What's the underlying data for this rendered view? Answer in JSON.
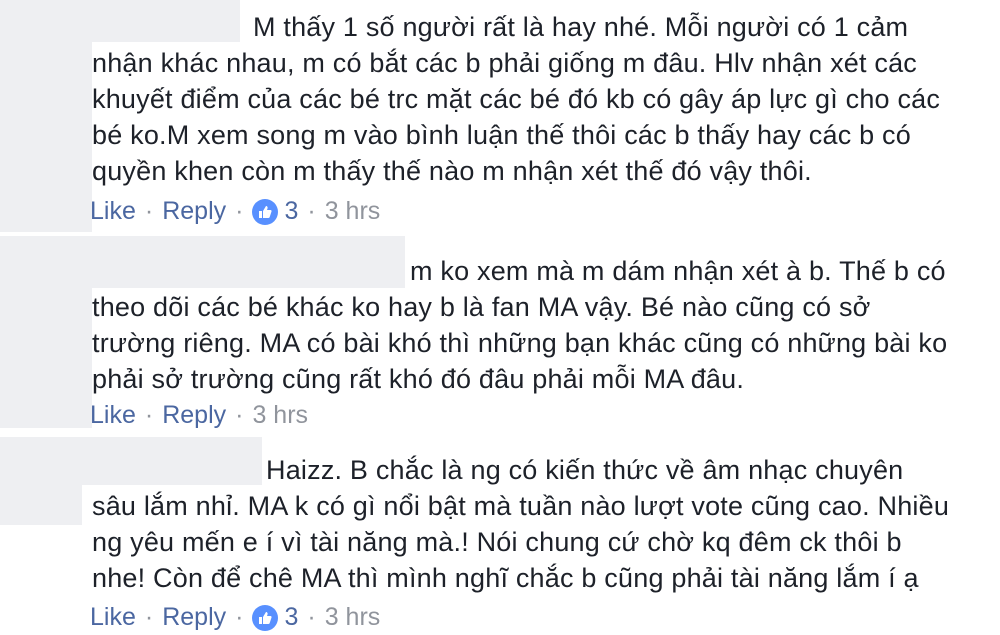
{
  "comments": [
    {
      "lines": [
        "M thấy 1 số người rất là hay nhé. Mỗi người có 1 cảm",
        "nhận khác nhau, m có bắt các b phải giống m đâu. Hlv nhận xét các",
        "khuyết điểm của các bé trc mặt các bé đó kb có gây áp lực gì cho các",
        "bé ko.M xem song m vào bình luận thế thôi các b thấy hay các b có",
        "quyền khen còn m thấy thế nào m nhận xét thế đó vậy thôi."
      ],
      "like": "Like",
      "reply": "Reply",
      "reactions": "3",
      "time": "3 hrs"
    },
    {
      "lines": [
        "m ko xem mà m dám nhận xét à b. Thế b có",
        "theo dõi các bé khác ko hay b là fan MA vậy. Bé nào cũng có sở",
        "trường riêng. MA có bài khó thì những bạn khác cũng có những bài ko",
        "phải sở trường cũng rất khó đó đâu phải mỗi MA đâu."
      ],
      "like": "Like",
      "reply": "Reply",
      "time": "3 hrs"
    },
    {
      "lines": [
        "Haizz. B chắc là ng có kiến thức về âm nhạc chuyên",
        "sâu lắm nhỉ. MA k có gì nổi bật mà tuần nào lượt vote cũng cao. Nhiều",
        "ng yêu mến e í vì tài năng mà.! Nói chung cứ chờ kq đêm ck thôi b",
        "nhe! Còn để chê MA thì mình nghĩ chắc b cũng phải tài năng lắm í ạ"
      ],
      "like": "Like",
      "reply": "Reply",
      "reactions": "3",
      "time": "3 hrs"
    }
  ],
  "separator": "·",
  "colors": {
    "link": "#4b67a1",
    "muted": "#90949c",
    "text": "#1d2129",
    "like_badge": "#5890ff",
    "blur": "#eeeff2"
  },
  "icons": {
    "reaction": "thumbs-up-icon"
  }
}
